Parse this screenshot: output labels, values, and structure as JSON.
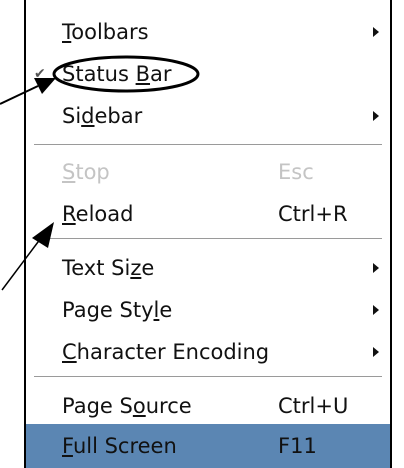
{
  "menu": {
    "items": [
      {
        "pre": "",
        "u": "T",
        "post": "oolbars",
        "shortcut": "",
        "submenu": true,
        "disabled": false,
        "highlighted": false
      },
      {
        "pre": "Status ",
        "u": "B",
        "post": "ar",
        "shortcut": "",
        "submenu": false,
        "disabled": false,
        "highlighted": false,
        "checked": true
      },
      {
        "pre": "Si",
        "u": "d",
        "post": "ebar",
        "shortcut": "",
        "submenu": true,
        "disabled": false,
        "highlighted": false
      },
      {
        "pre": "",
        "u": "S",
        "post": "top",
        "shortcut": "Esc",
        "submenu": false,
        "disabled": true,
        "highlighted": false
      },
      {
        "pre": "",
        "u": "R",
        "post": "eload",
        "shortcut": "Ctrl+R",
        "submenu": false,
        "disabled": false,
        "highlighted": false
      },
      {
        "pre": "Text Si",
        "u": "z",
        "post": "e",
        "shortcut": "",
        "submenu": true,
        "disabled": false,
        "highlighted": false
      },
      {
        "pre": "Page Sty",
        "u": "l",
        "post": "e",
        "shortcut": "",
        "submenu": true,
        "disabled": false,
        "highlighted": false
      },
      {
        "pre": "",
        "u": "C",
        "post": "haracter Encoding",
        "shortcut": "",
        "submenu": true,
        "disabled": false,
        "highlighted": false
      },
      {
        "pre": "Page S",
        "u": "o",
        "post": "urce",
        "shortcut": "Ctrl+U",
        "submenu": false,
        "disabled": false,
        "highlighted": false
      },
      {
        "pre": "",
        "u": "F",
        "post": "ull Screen",
        "shortcut": "F11",
        "submenu": false,
        "disabled": false,
        "highlighted": true
      }
    ]
  },
  "colors": {
    "highlight": "#5b86b3",
    "disabled_text": "#c4c4c4",
    "annotation": "#000000"
  },
  "icons": {
    "submenu": "submenu-arrow-icon",
    "check": "check-mark-icon"
  }
}
